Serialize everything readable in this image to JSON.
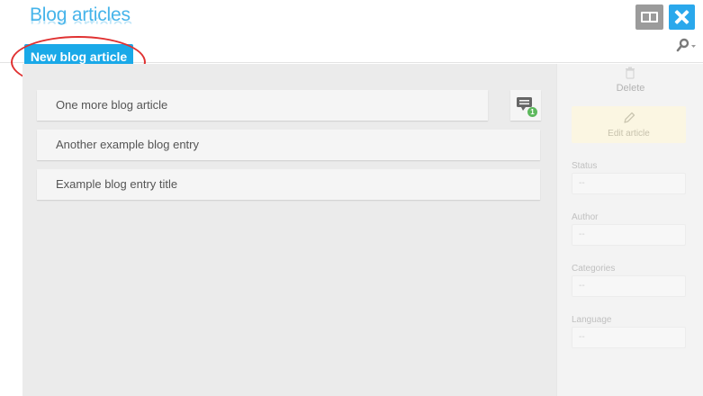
{
  "header": {
    "title": "Blog articles",
    "new_button": "New blog article"
  },
  "articles": [
    {
      "title": "One more blog article",
      "comment_count": "1"
    },
    {
      "title": "Another example blog entry"
    },
    {
      "title": "Example blog entry title"
    }
  ],
  "sidebar": {
    "delete_label": "Delete",
    "edit_label": "Edit article",
    "fields": [
      {
        "label": "Status",
        "value": "--"
      },
      {
        "label": "Author",
        "value": "--"
      },
      {
        "label": "Categories",
        "value": "--"
      },
      {
        "label": "Language",
        "value": "--"
      }
    ]
  },
  "icons": {
    "split": "split-view-icon",
    "close": "close-icon",
    "search": "search-icon",
    "comment": "comment-icon",
    "trash": "trash-icon",
    "edit": "pencil-icon"
  },
  "colors": {
    "accent": "#1aa9e8",
    "title": "#46b4ea",
    "highlight": "#e03131",
    "badge": "#5cb85c"
  }
}
